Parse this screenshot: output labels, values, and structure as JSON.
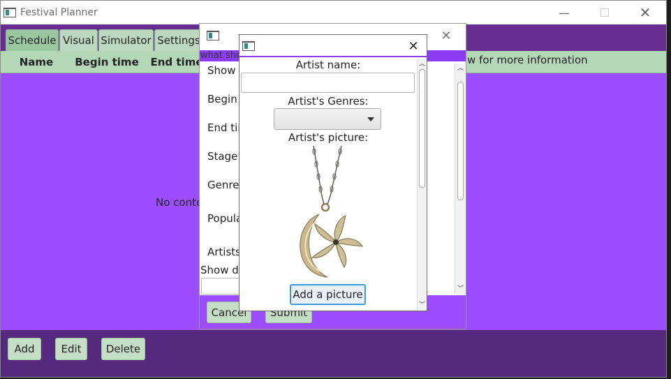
{
  "main_window": {
    "title": "Festival Planner",
    "tabs": [
      {
        "label": "Schedule"
      },
      {
        "label": "Visual"
      },
      {
        "label": "Simulator"
      },
      {
        "label": "Settings"
      }
    ],
    "table_columns": [
      "Name",
      "Begin time",
      "End time"
    ],
    "empty_text": "No conten",
    "info_text": "w for more information",
    "bottom_buttons": {
      "add": "Add",
      "edit": "Edit",
      "delete": "Delete"
    }
  },
  "show_dialog": {
    "header_text": "what sho",
    "fields": [
      "Show n",
      "Begin t",
      "End tim",
      "Stage:",
      "Genre:",
      "Popula",
      "Artists:",
      "Show de"
    ],
    "cancel_label": "Cancel",
    "submit_label": "Submit"
  },
  "artist_dialog": {
    "artist_name_label": "Artist name:",
    "artist_name_value": "",
    "genres_label": "Artist's Genres:",
    "genres_selected": "",
    "picture_label": "Artist's picture:",
    "add_picture_label": "Add a picture"
  },
  "colors": {
    "tab_bar": "#672d91",
    "content_bg": "#9b4dff",
    "bottom_bar": "#552a7e",
    "button_bg": "#c5dfc6",
    "focus_blue": "#3d98d8"
  },
  "icons": [
    "app-icon",
    "minimize-icon",
    "maximize-icon",
    "close-icon",
    "chevron-down-icon",
    "chevron-up-icon",
    "dropdown-arrow-icon"
  ]
}
